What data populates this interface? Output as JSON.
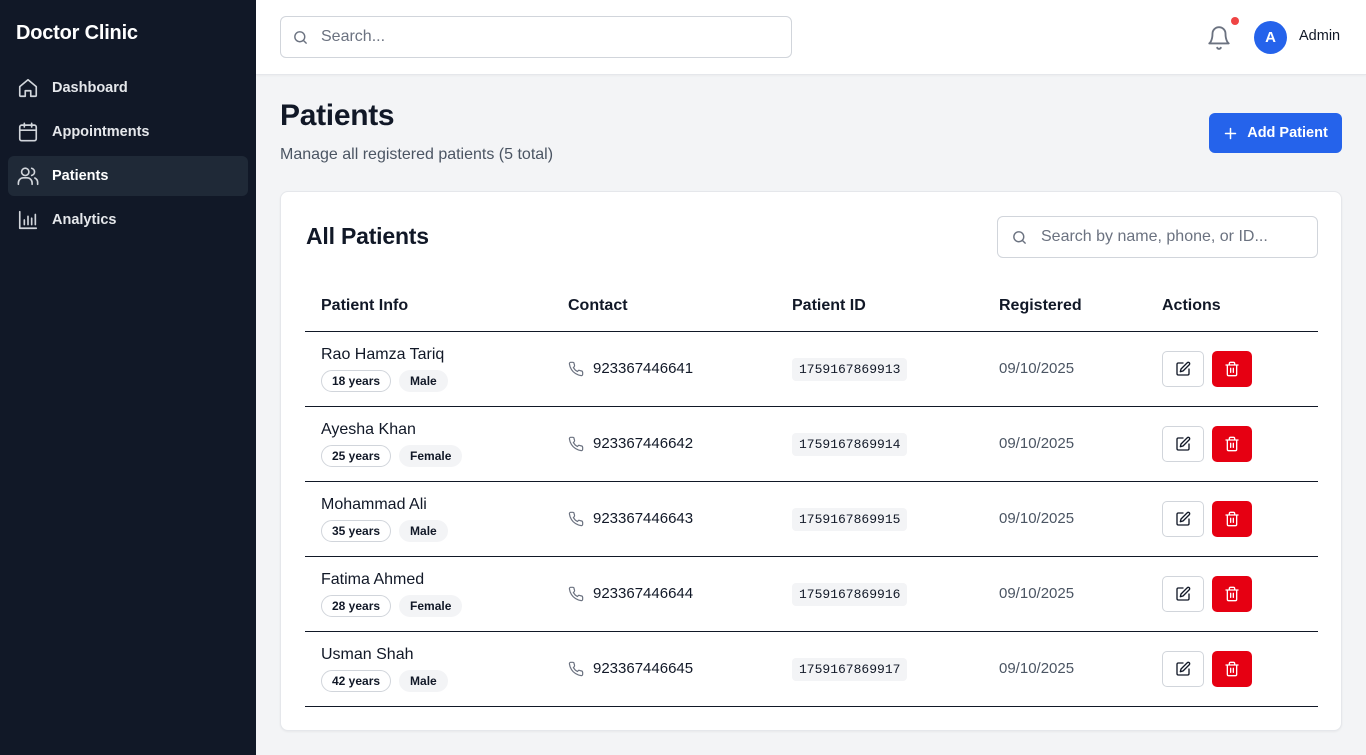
{
  "sidebar": {
    "brand": "Doctor Clinic",
    "items": [
      {
        "label": "Dashboard",
        "icon": "home-icon"
      },
      {
        "label": "Appointments",
        "icon": "calendar-icon"
      },
      {
        "label": "Patients",
        "icon": "users-icon",
        "active": true
      },
      {
        "label": "Analytics",
        "icon": "bar-chart-icon"
      }
    ]
  },
  "topbar": {
    "search_placeholder": "Search...",
    "avatar_initial": "A",
    "user_name": "Admin",
    "notification_dot_color": "#ef4444"
  },
  "page": {
    "title": "Patients",
    "subtitle": "Manage all registered patients (5 total)",
    "add_button_label": "Add Patient"
  },
  "card": {
    "title": "All Patients",
    "search_placeholder": "Search by name, phone, or ID...",
    "columns": [
      "Patient Info",
      "Contact",
      "Patient ID",
      "Registered",
      "Actions"
    ],
    "patients": [
      {
        "name": "Rao Hamza Tariq",
        "age": "18 years",
        "gender": "Male",
        "phone": "923367446641",
        "id": "1759167869913",
        "registered": "09/10/2025"
      },
      {
        "name": "Ayesha Khan",
        "age": "25 years",
        "gender": "Female",
        "phone": "923367446642",
        "id": "1759167869914",
        "registered": "09/10/2025"
      },
      {
        "name": "Mohammad Ali",
        "age": "35 years",
        "gender": "Male",
        "phone": "923367446643",
        "id": "1759167869915",
        "registered": "09/10/2025"
      },
      {
        "name": "Fatima Ahmed",
        "age": "28 years",
        "gender": "Female",
        "phone": "923367446644",
        "id": "1759167869916",
        "registered": "09/10/2025"
      },
      {
        "name": "Usman Shah",
        "age": "42 years",
        "gender": "Male",
        "phone": "923367446645",
        "id": "1759167869917",
        "registered": "09/10/2025"
      }
    ]
  },
  "colors": {
    "sidebar_bg": "#111827",
    "primary": "#2563eb",
    "danger": "#e60012"
  }
}
